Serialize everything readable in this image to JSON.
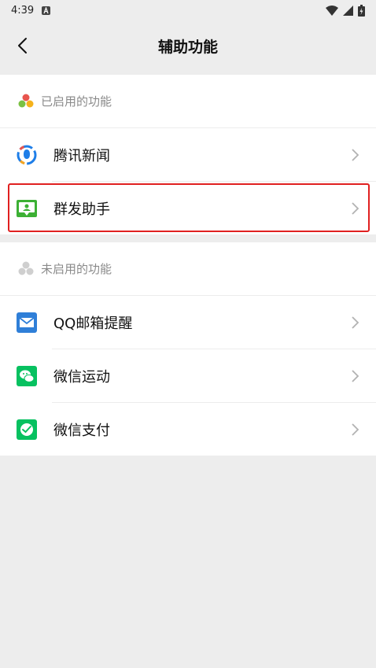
{
  "status_bar": {
    "time": "4:39"
  },
  "nav": {
    "title": "辅助功能"
  },
  "enabled_section": {
    "header": "已启用的功能",
    "items": [
      {
        "label": "腾讯新闻",
        "icon": "tencent-news-icon"
      },
      {
        "label": "群发助手",
        "icon": "mass-send-icon",
        "highlighted": true
      }
    ]
  },
  "disabled_section": {
    "header": "未启用的功能",
    "items": [
      {
        "label": "QQ邮箱提醒",
        "icon": "qq-mail-icon"
      },
      {
        "label": "微信运动",
        "icon": "wechat-sport-icon"
      },
      {
        "label": "微信支付",
        "icon": "wechat-pay-icon"
      }
    ]
  },
  "colors": {
    "background": "#ededed",
    "highlight_border": "#e02020",
    "wechat_green": "#07c160",
    "mail_blue": "#2f7fd8"
  }
}
